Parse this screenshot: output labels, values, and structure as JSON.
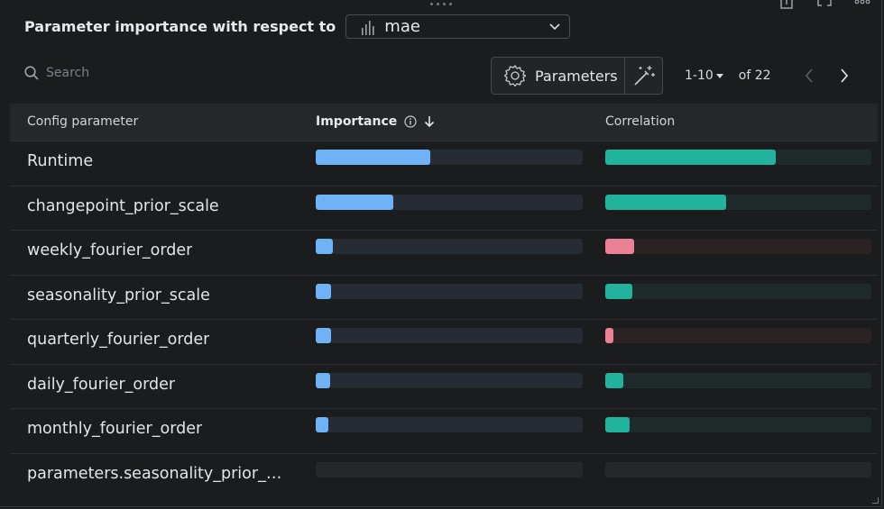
{
  "header": {
    "title": "Parameter importance with respect to",
    "metric": "mae"
  },
  "toolbar": {
    "search_placeholder": "Search",
    "parameters_label": "Parameters",
    "range_label": "1-10",
    "of_label": "of 22"
  },
  "table": {
    "columns": {
      "param": "Config parameter",
      "importance": "Importance",
      "correlation": "Correlation"
    },
    "rows": [
      {
        "name": "Runtime",
        "importance": 0.43,
        "correlation": 0.64,
        "sign": "pos"
      },
      {
        "name": "changepoint_prior_scale",
        "importance": 0.29,
        "correlation": 0.455,
        "sign": "pos"
      },
      {
        "name": "weekly_fourier_order",
        "importance": 0.065,
        "correlation": 0.11,
        "sign": "neg"
      },
      {
        "name": "seasonality_prior_scale",
        "importance": 0.058,
        "correlation": 0.1,
        "sign": "pos"
      },
      {
        "name": "quarterly_fourier_order",
        "importance": 0.058,
        "correlation": 0.03,
        "sign": "neg"
      },
      {
        "name": "daily_fourier_order",
        "importance": 0.055,
        "correlation": 0.068,
        "sign": "pos"
      },
      {
        "name": "monthly_fourier_order",
        "importance": 0.048,
        "correlation": 0.092,
        "sign": "pos"
      },
      {
        "name": "parameters.seasonality_prior_s…",
        "importance": null,
        "correlation": null,
        "sign": "none"
      }
    ]
  },
  "colors": {
    "importance_fill": "#6fb3f6",
    "positive_fill": "#21b39d",
    "negative_fill": "#ec8196"
  }
}
